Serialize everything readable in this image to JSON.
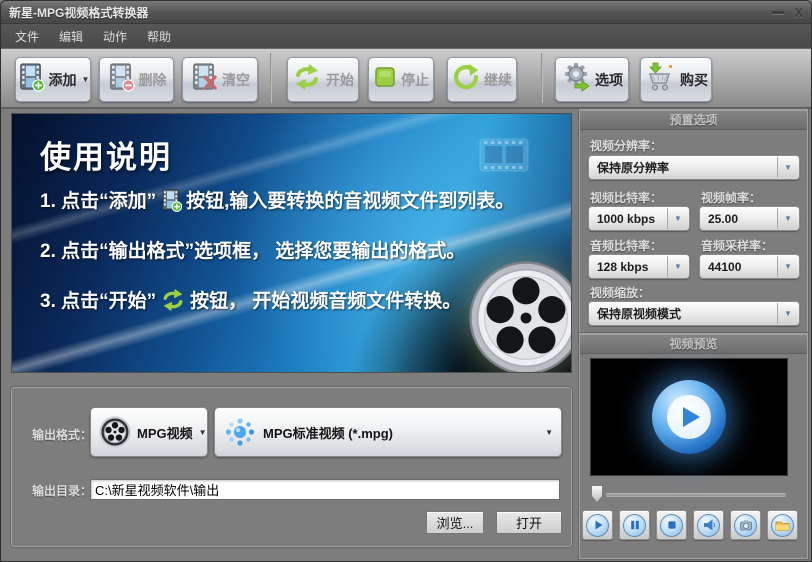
{
  "window": {
    "title": "新星-MPG视频格式转换器"
  },
  "icons": {
    "minimize": "—",
    "close": "X",
    "dropdown_arrow": "▼",
    "caret": "▼"
  },
  "menu": {
    "file": "文件",
    "edit": "编辑",
    "action": "动作",
    "help": "帮助"
  },
  "toolbar": {
    "add": "添加",
    "remove": "删除",
    "clear": "清空",
    "start": "开始",
    "stop": "停止",
    "resume": "继续",
    "options": "选项",
    "buy": "购买"
  },
  "banner": {
    "title": "使用说明",
    "step1_pre": "1. 点击“添加”",
    "step1_post": "按钮,输入要转换的音视频文件到列表。",
    "step2": "2. 点击“输出格式”选项框， 选择您要输出的格式。",
    "step3_pre": "3. 点击“开始”",
    "step3_post": "按钮， 开始视频音频文件转换。"
  },
  "presets": {
    "title": "预置选项",
    "resolution_label": "视频分辨率：",
    "resolution_value": "保持原分辨率",
    "video_bitrate_label": "视频比特率：",
    "video_bitrate_value": "1000 kbps",
    "framerate_label": "视频帧率：",
    "framerate_value": "25.00",
    "audio_bitrate_label": "音频比特率：",
    "audio_bitrate_value": "128 kbps",
    "samplerate_label": "音频采样率：",
    "samplerate_value": "44100",
    "scale_label": "视频缩放：",
    "scale_value": "保持原视频模式"
  },
  "preview": {
    "title": "视频预览"
  },
  "output": {
    "format_label": "输出格式：",
    "format_value": "MPG视频",
    "profile_value": "MPG标准视频 (*.mpg)",
    "dir_label": "输出目录：",
    "dir_value": "C:\\新星视频软件\\输出",
    "browse_label": "浏览...",
    "open_label": "打开"
  },
  "colors": {
    "accent_green": "#8cc63f",
    "banner_blue": "#1d7ec2",
    "player_blue": "#2f86d8"
  }
}
